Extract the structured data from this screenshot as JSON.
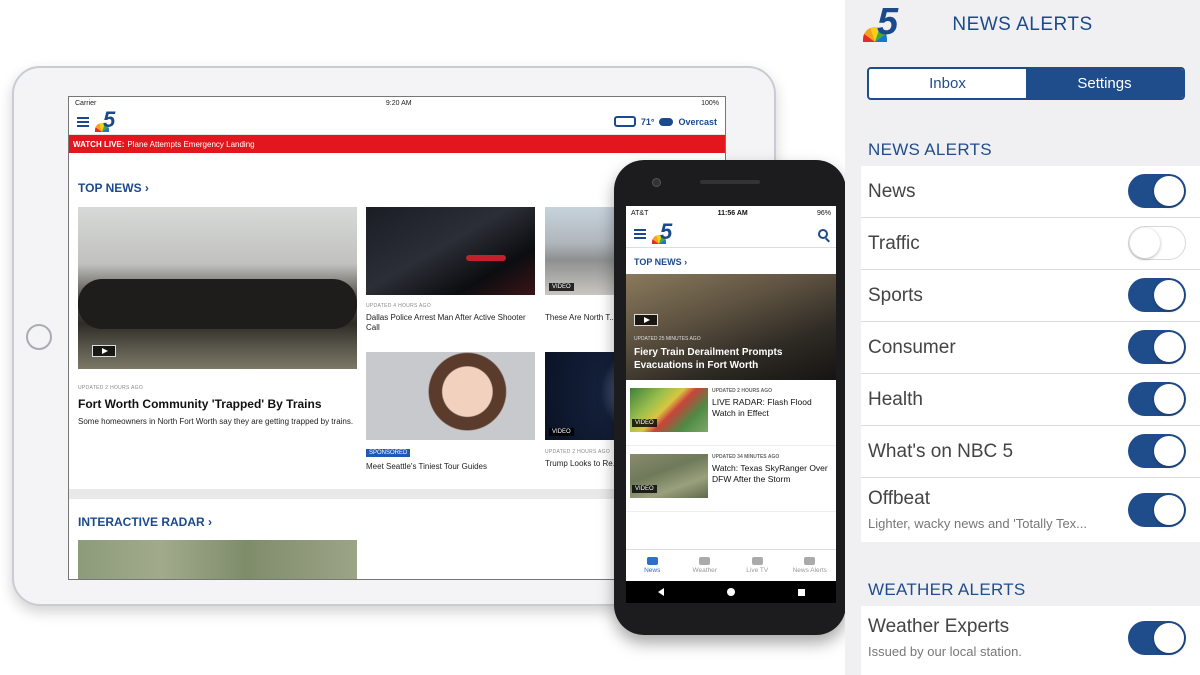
{
  "tablet": {
    "status": {
      "carrier": "Carrier",
      "time": "9:20 AM",
      "battery": "100%"
    },
    "weather": {
      "temp": "71°",
      "condition": "Overcast"
    },
    "breaking": {
      "tag": "WATCH LIVE:",
      "text": "Plane Attempts Emergency Landing"
    },
    "top_news_label": "TOP NEWS ›",
    "lead": {
      "meta": "UPDATED 2 HOURS AGO",
      "headline": "Fort Worth Community 'Trapped' By Trains",
      "summary": "Some homeowners in North Fort Worth say they are getting trapped by trains."
    },
    "story2": {
      "meta": "UPDATED 4 HOURS AGO",
      "title": "Dallas Police Arrest Man After Active Shooter Call"
    },
    "story3": {
      "video_tag": "VIDEO",
      "title": "These Are North T... Construction Proj..."
    },
    "story4": {
      "badge": "SPONSORED",
      "title": "Meet Seattle's Tiniest Tour Guides"
    },
    "story5": {
      "video_tag": "VIDEO",
      "meta": "UPDATED 2 HOURS AGO",
      "title": "Trump Looks to Re... in Address to Con..."
    },
    "radar_label": "INTERACTIVE RADAR ›"
  },
  "phone": {
    "status": {
      "carrier": "AT&T",
      "time": "11:56 AM",
      "battery": "96%"
    },
    "top_news_label": "TOP NEWS ›",
    "hero": {
      "meta": "UPDATED 25 MINUTES AGO",
      "title": "Fiery Train Derailment Prompts Evacuations in Fort Worth"
    },
    "stories": [
      {
        "meta": "UPDATED 2 HOURS AGO",
        "title": "LIVE RADAR: Flash Flood Watch in Effect",
        "tag": "VIDEO"
      },
      {
        "meta": "UPDATED 34 MINUTES AGO",
        "title": "Watch: Texas SkyRanger Over DFW After the Storm",
        "tag": "VIDEO"
      }
    ],
    "tabs": [
      "News",
      "Weather",
      "Live TV",
      "News Alerts"
    ]
  },
  "alerts": {
    "title": "NEWS ALERTS",
    "segments": [
      "Inbox",
      "Settings"
    ],
    "news_section": "NEWS ALERTS",
    "items": [
      {
        "label": "News",
        "on": true
      },
      {
        "label": "Traffic",
        "on": false
      },
      {
        "label": "Sports",
        "on": true
      },
      {
        "label": "Consumer",
        "on": true
      },
      {
        "label": "Health",
        "on": true
      },
      {
        "label": "What's on NBC 5",
        "on": true
      },
      {
        "label": "Offbeat",
        "sub": "Lighter, wacky news and 'Totally Tex...",
        "on": true
      }
    ],
    "weather_section": "WEATHER ALERTS",
    "weather_items": [
      {
        "label": "Weather Experts",
        "sub": "Issued by our local station.",
        "on": true
      }
    ]
  },
  "colors": {
    "brand_blue": "#1f4d8c",
    "breaking_red": "#e3161e",
    "link_blue": "#2f6fc7"
  }
}
